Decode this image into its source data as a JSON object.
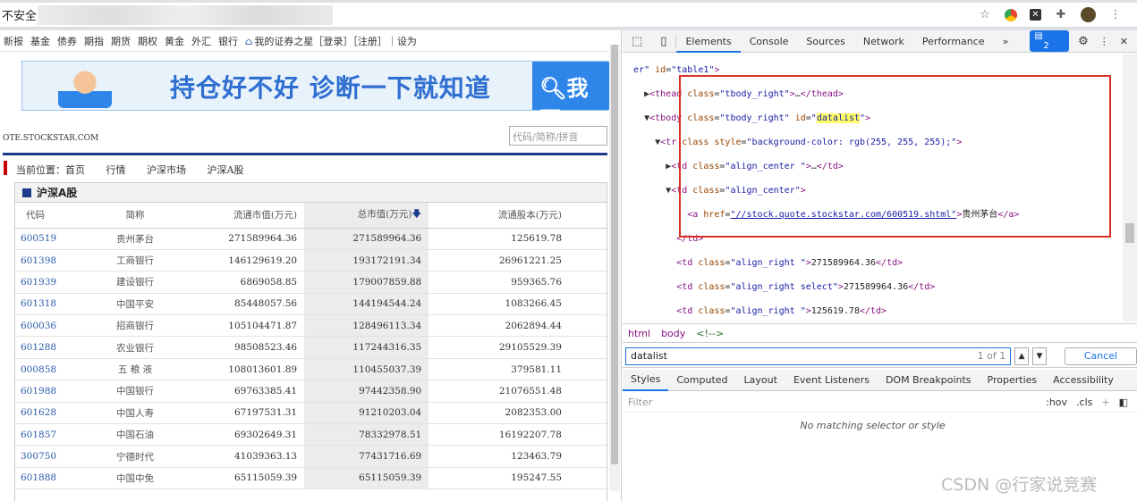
{
  "browser": {
    "security_label": "不安全"
  },
  "site": {
    "nav": [
      "新报",
      "基金",
      "债券",
      "期指",
      "期货",
      "期权",
      "黄金",
      "外汇",
      "银行"
    ],
    "nav_right": "我的证券之星［登录］［注册］｜设为",
    "banner_text": "持仓好不好  诊断一下就知道",
    "banner_button": "我要",
    "logo_text": "OTE.STOCKSTAR.COM",
    "search_placeholder": "代码/简称/拼音",
    "breadcrumb": [
      "当前位置：首页",
      "行情",
      "沪深市场",
      "沪深A股"
    ],
    "panel_title": "沪深A股",
    "table": {
      "headers": [
        "代码",
        "简称",
        "流通市值(万元)",
        "总市值(万元)",
        "流通股本(万元)"
      ],
      "rows": [
        [
          "600519",
          "贵州茅台",
          "271589964.36",
          "271589964.36",
          "125619.78"
        ],
        [
          "601398",
          "工商银行",
          "146129619.20",
          "193172191.34",
          "26961221.25"
        ],
        [
          "601939",
          "建设银行",
          "6869058.85",
          "179007859.88",
          "959365.76"
        ],
        [
          "601318",
          "中国平安",
          "85448057.56",
          "144194544.24",
          "1083266.45"
        ],
        [
          "600036",
          "招商银行",
          "105104471.87",
          "128496113.34",
          "2062894.44"
        ],
        [
          "601288",
          "农业银行",
          "98508523.46",
          "117244316.35",
          "29105529.39"
        ],
        [
          "000858",
          "五 粮 液",
          "108013601.89",
          "110455037.39",
          "379581.11"
        ],
        [
          "601988",
          "中国银行",
          "69763385.41",
          "97442358.90",
          "21076551.48"
        ],
        [
          "601628",
          "中国人寿",
          "67197531.31",
          "91210203.04",
          "2082353.00"
        ],
        [
          "601857",
          "中国石油",
          "69302649.31",
          "78332978.51",
          "16192207.78"
        ],
        [
          "300750",
          "宁德时代",
          "41039363.13",
          "77431716.69",
          "123463.79"
        ],
        [
          "601888",
          "中国中免",
          "65115059.39",
          "65115059.39",
          "195247.55"
        ]
      ]
    }
  },
  "devtools": {
    "tabs": [
      "Elements",
      "Console",
      "Sources",
      "Network",
      "Performance",
      "»"
    ],
    "issues_count": "2",
    "breadcrumbs": [
      "html",
      "body",
      "<!-->"
    ],
    "search_value": "datalist",
    "search_count": "1 of 1",
    "cancel_label": "Cancel",
    "style_tabs": [
      "Styles",
      "Computed",
      "Layout",
      "Event Listeners",
      "DOM Breakpoints",
      "Properties",
      "Accessibility"
    ],
    "filter_placeholder": "Filter",
    "hov": ":hov",
    "cls": ".cls",
    "no_match": "No matching selector or style"
  },
  "watermark": "CSDN @行家说竞赛"
}
